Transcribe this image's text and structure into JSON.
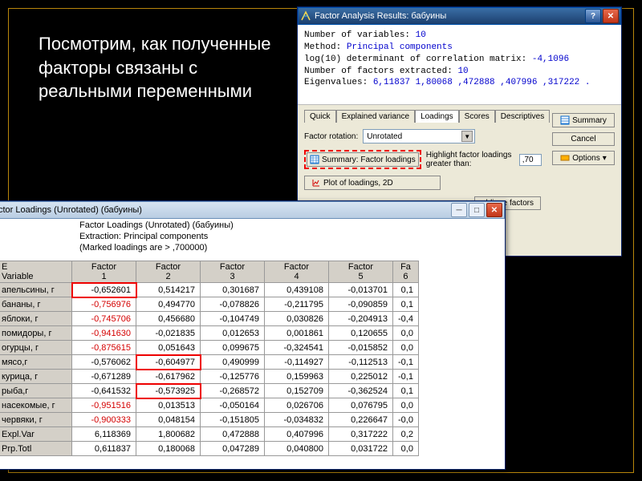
{
  "slide": {
    "text": "Посмотрим, как полученные факторы связаны с реальными переменными"
  },
  "results": {
    "title": "Factor Analysis Results: бабуины",
    "num_vars_label": "Number of variables:",
    "num_vars": "10",
    "method_label": "Method:",
    "method": "Principal components",
    "logdet_label": "log(10) determinant of correlation matrix:",
    "logdet": "-4,1096",
    "num_factors_label": "Number of factors extracted:",
    "num_factors": "10",
    "eigen_label": "Eigenvalues:",
    "eigen": "6,11837  1,80068  ,472888  ,407996  ,317222  .",
    "tabs": [
      "Quick",
      "Explained variance",
      "Loadings",
      "Scores",
      "Descriptives"
    ],
    "summary_btn": "Summary",
    "cancel_btn": "Cancel",
    "options_btn": "Options",
    "rotation_label": "Factor rotation:",
    "rotation_value": "Unrotated",
    "summary_loadings_btn": "Summary: Factor loadings",
    "highlight_label": "Highlight factor loadings greater than:",
    "highlight_value": ",70",
    "plot2d_btn": "Plot of loadings, 2D",
    "oblique_btn": "oblique factors"
  },
  "loadings": {
    "title": "ctor Loadings (Unrotated) (бабуины)",
    "header1": "Factor Loadings (Unrotated) (бабуины)",
    "header2": "Extraction: Principal components",
    "header3": "(Marked loadings are > ,700000)",
    "corner_top": "Variable",
    "corner_side": "E",
    "factors": [
      "Factor 1",
      "Factor 2",
      "Factor 3",
      "Factor 4",
      "Factor 5",
      "Fa 6"
    ],
    "rows": [
      {
        "var": "апельсины, г",
        "cells": [
          "-0,652601",
          "0,514217",
          "0,301687",
          "0,439108",
          "-0,013701"
        ],
        "f6": "0,1",
        "highlight": [
          true,
          false,
          false,
          false,
          false
        ],
        "negcol1": false,
        "box": [
          0
        ]
      },
      {
        "var": "бананы, г",
        "cells": [
          "-0,756976",
          "0,494770",
          "-0,078826",
          "-0,211795",
          "-0,090859"
        ],
        "f6": "0,1",
        "highlight": [
          true,
          false,
          false,
          false,
          false
        ],
        "negcol1": true
      },
      {
        "var": "яблоки, г",
        "cells": [
          "-0,745706",
          "0,456680",
          "-0,104749",
          "0,030826",
          "-0,204913"
        ],
        "f6": "-0,4",
        "highlight": [
          true,
          false,
          false,
          false,
          false
        ],
        "negcol1": true
      },
      {
        "var": "помидоры, г",
        "cells": [
          "-0,941630",
          "-0,021835",
          "0,012653",
          "0,001861",
          "0,120655"
        ],
        "f6": "0,0",
        "highlight": [
          true,
          false,
          false,
          false,
          false
        ],
        "negcol1": true
      },
      {
        "var": "огурцы, г",
        "cells": [
          "-0,875615",
          "0,051643",
          "0,099675",
          "-0,324541",
          "-0,015852"
        ],
        "f6": "0,0",
        "highlight": [
          true,
          false,
          false,
          false,
          false
        ],
        "negcol1": true
      },
      {
        "var": "мясо,г",
        "cells": [
          "-0,576062",
          "-0,604977",
          "0,490999",
          "-0,114927",
          "-0,112513"
        ],
        "f6": "-0,1",
        "highlight": [
          false,
          false,
          false,
          false,
          false
        ],
        "negcol1": false,
        "box": [
          1
        ]
      },
      {
        "var": "курица, г",
        "cells": [
          "-0,671289",
          "-0,617962",
          "-0,125776",
          "0,159963",
          "0,225012"
        ],
        "f6": "-0,1",
        "highlight": [
          false,
          false,
          false,
          false,
          false
        ],
        "negcol1": false
      },
      {
        "var": "рыба,г",
        "cells": [
          "-0,641532",
          "-0,573925",
          "-0,268572",
          "0,152709",
          "-0,362524"
        ],
        "f6": "0,1",
        "highlight": [
          false,
          false,
          false,
          false,
          false
        ],
        "negcol1": false,
        "box": [
          1
        ]
      },
      {
        "var": "насекомые, г",
        "cells": [
          "-0,951516",
          "0,013513",
          "-0,050164",
          "0,026706",
          "0,076795"
        ],
        "f6": "0,0",
        "highlight": [
          true,
          false,
          false,
          false,
          false
        ],
        "negcol1": true
      },
      {
        "var": "червяки, г",
        "cells": [
          "-0,900333",
          "0,048154",
          "-0,151805",
          "-0,034832",
          "0,226647"
        ],
        "f6": "-0,0",
        "highlight": [
          true,
          false,
          false,
          false,
          false
        ],
        "negcol1": true
      },
      {
        "var": "Expl.Var",
        "cells": [
          "6,118369",
          "1,800682",
          "0,472888",
          "0,407996",
          "0,317222"
        ],
        "f6": "0,2",
        "highlight": [
          false,
          false,
          false,
          false,
          false
        ],
        "negcol1": false
      },
      {
        "var": "Prp.Totl",
        "cells": [
          "0,611837",
          "0,180068",
          "0,047289",
          "0,040800",
          "0,031722"
        ],
        "f6": "0,0",
        "highlight": [
          false,
          false,
          false,
          false,
          false
        ],
        "negcol1": false
      }
    ]
  }
}
